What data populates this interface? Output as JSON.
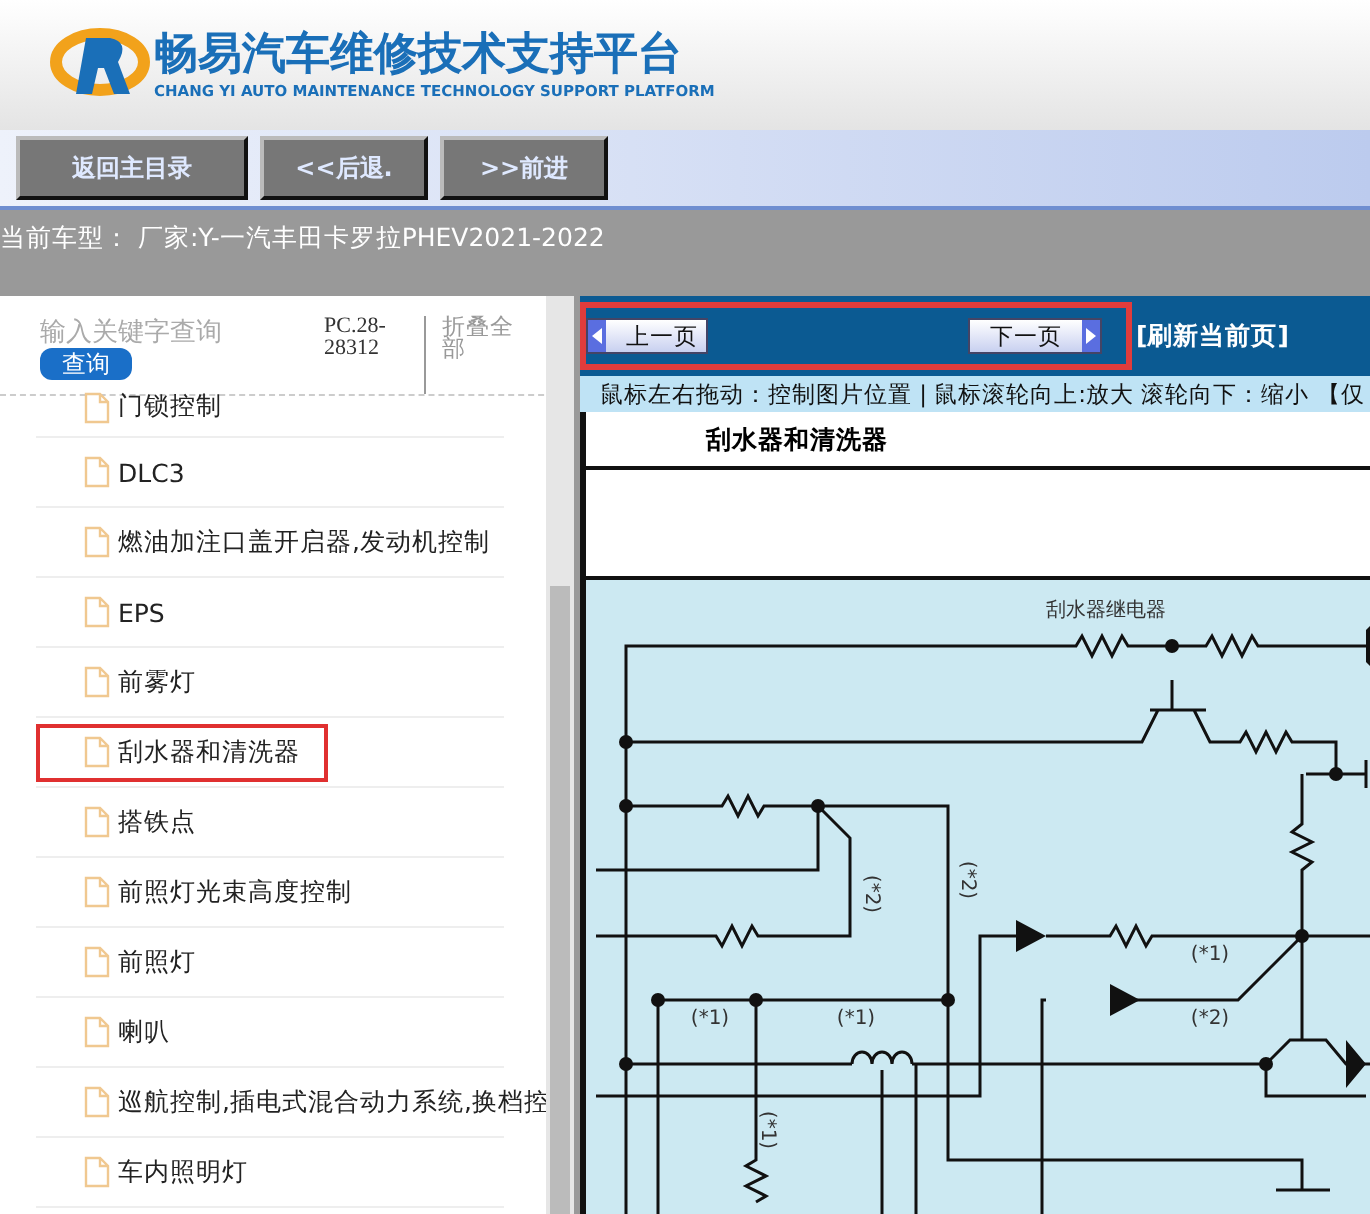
{
  "header": {
    "title": "畅易汽车维修技术支持平台",
    "subtitle": "CHANG YI AUTO MAINTENANCE TECHNOLOGY SUPPORT PLATFORM"
  },
  "toolbar": {
    "buttons": [
      "返回主目录",
      "<<后退.",
      ">>前进"
    ]
  },
  "vehicle": {
    "label": "当前车型：",
    "value": "厂家:Y-一汽丰田卡罗拉PHEV2021-2022"
  },
  "sidebar": {
    "search": {
      "placeholder": "输入关键字查询",
      "button": "查询"
    },
    "code": "PC.28-28312",
    "collapse": "折叠全部",
    "items": [
      {
        "label": "门锁控制",
        "selected": false
      },
      {
        "label": "DLC3",
        "selected": false
      },
      {
        "label": "燃油加注口盖开启器,发动机控制",
        "selected": false
      },
      {
        "label": "EPS",
        "selected": false
      },
      {
        "label": "前雾灯",
        "selected": false
      },
      {
        "label": "刮水器和清洗器",
        "selected": true
      },
      {
        "label": "搭铁点",
        "selected": false
      },
      {
        "label": "前照灯光束高度控制",
        "selected": false
      },
      {
        "label": "前照灯",
        "selected": false
      },
      {
        "label": "喇叭",
        "selected": false
      },
      {
        "label": "巡航控制,插电式混合动力系统,换档控",
        "selected": false
      },
      {
        "label": "车内照明灯",
        "selected": false
      }
    ]
  },
  "viewer": {
    "prev": "上一页",
    "next": "下一页",
    "refresh": "[刷新当前页]",
    "hint": "鼠标左右拖动：控制图片位置 | 鼠标滚轮向上:放大  滚轮向下：缩小 【仅",
    "page_title": "刮水器和清洗器",
    "diagram_labels": [
      "刮水器继电器",
      "(*2)",
      "(*2)",
      "(*1)",
      "(*1)",
      "(*1)",
      "(*2)",
      "(*1)"
    ]
  }
}
